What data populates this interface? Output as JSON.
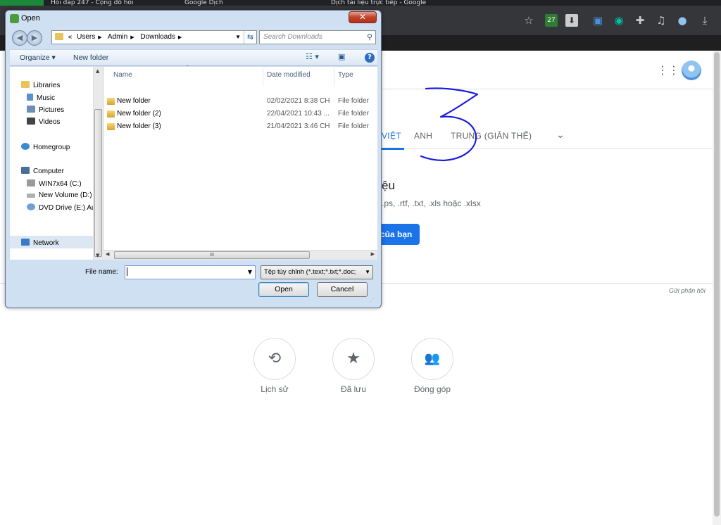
{
  "browser": {
    "tabs": [
      "Hỏi đáp 247 - Cộng đồ hỏi",
      "Google Dịch",
      "Dịch tài liệu trực tiếp - Google"
    ],
    "extension_badge": "27"
  },
  "translate": {
    "languages": [
      "VIỆT",
      "ANH",
      "TRUNG (GIẢN THỂ)"
    ],
    "title_fragment": "ệu",
    "formats_fragment": ".ps, .rtf, .txt, .xls hoặc .xlsx",
    "button_fragment": "của bạn",
    "feedback": "Gửi phản hồi",
    "shortcuts": [
      {
        "label": "Lịch sử",
        "icon": "history-icon"
      },
      {
        "label": "Đã lưu",
        "icon": "star-icon"
      },
      {
        "label": "Đóng góp",
        "icon": "contribute-icon"
      }
    ],
    "annotation_color": "#1a1adf"
  },
  "dialog": {
    "title": "Open",
    "breadcrumb": [
      "«",
      "Users",
      "Admin",
      "Downloads"
    ],
    "search_placeholder": "Search Downloads",
    "organize": "Organize ▾",
    "new_folder": "New folder",
    "nav": {
      "libraries": "Libraries",
      "music": "Music",
      "pictures": "Pictures",
      "videos": "Videos",
      "homegroup": "Homegroup",
      "computer": "Computer",
      "drive_c": "WIN7x64 (C:)",
      "drive_d": "New Volume (D:)",
      "drive_e": "DVD Drive (E:) Au",
      "network": "Network"
    },
    "columns": {
      "name": "Name",
      "date": "Date modified",
      "type": "Type"
    },
    "files": [
      {
        "name": "New folder",
        "date": "02/02/2021 8:38 CH",
        "type": "File folder"
      },
      {
        "name": "New folder (2)",
        "date": "22/04/2021 10:43 ...",
        "type": "File folder"
      },
      {
        "name": "New folder (3)",
        "date": "21/04/2021 3:46 CH",
        "type": "File folder"
      }
    ],
    "filename_label": "File name:",
    "filename_value": "",
    "filter": "Tệp tùy chỉnh (*.text;*.txt;*.doc;",
    "open": "Open",
    "cancel": "Cancel"
  }
}
